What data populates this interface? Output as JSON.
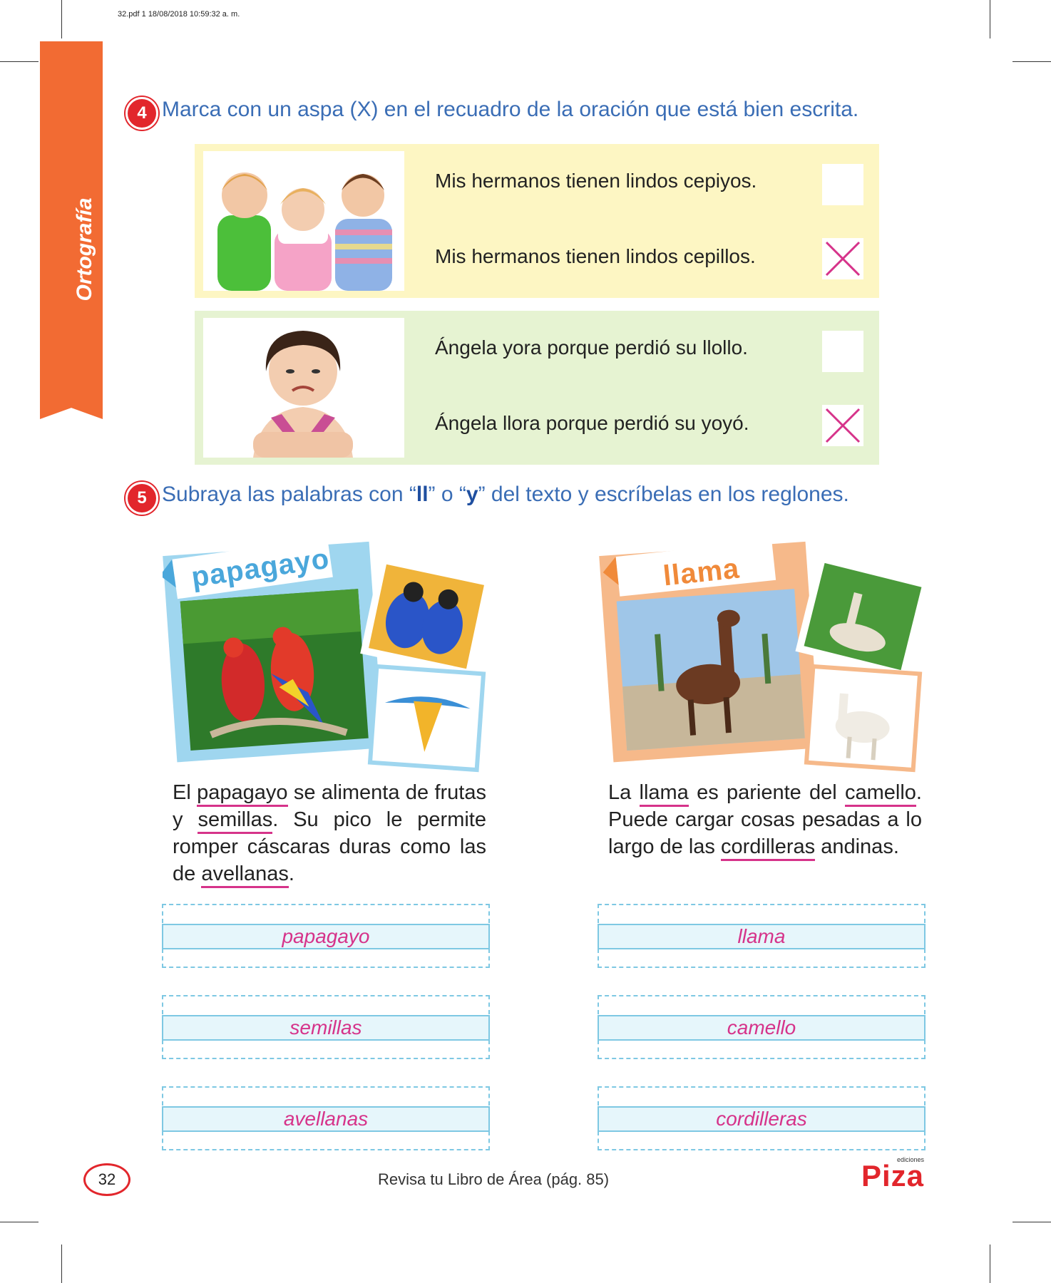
{
  "print_info": "32.pdf   1   18/08/2018   10:59:32 a. m.",
  "side_tab": {
    "label": "Ortografía"
  },
  "colors": {
    "orange": "#f26b33",
    "red": "#e2262c",
    "blue_text": "#3a6db5",
    "magenta": "#d6338a",
    "yellow_panel": "#fdf6c3",
    "green_panel": "#e6f3d2"
  },
  "exercise4": {
    "number": "4",
    "instruction": "Marca con un aspa (X) en el recuadro de la oración que está bien escrita.",
    "groups": [
      {
        "image": "children-brushing-teeth-photo",
        "options": [
          {
            "text": "Mis hermanos tienen lindos cepiyos.",
            "checked": false
          },
          {
            "text": "Mis hermanos tienen lindos cepillos.",
            "checked": true
          }
        ]
      },
      {
        "image": "crying-girl-photo",
        "options": [
          {
            "text": "Ángela yora porque perdió su llollo.",
            "checked": false
          },
          {
            "text": "Ángela llora porque perdió su yoyó.",
            "checked": true
          }
        ]
      }
    ]
  },
  "exercise5": {
    "number": "5",
    "instruction_pre": "Subraya las palabras con “",
    "instruction_ll": "ll",
    "instruction_mid": "” o “",
    "instruction_y": "y",
    "instruction_post": "” del texto y escríbelas en los reglones.",
    "cards": [
      {
        "label": "papagayo",
        "text_parts": [
          [
            "El ",
            false
          ],
          [
            "papagayo",
            true
          ],
          [
            " se alimenta de frutas y ",
            false
          ],
          [
            "semillas",
            true
          ],
          [
            ". Su pico le permite romper cáscaras duras como las de ",
            false
          ],
          [
            "avellanas",
            true
          ],
          [
            ".",
            false
          ]
        ],
        "answers": [
          "papagayo",
          "semillas",
          "avellanas"
        ]
      },
      {
        "label": "llama",
        "text_parts": [
          [
            "La ",
            false
          ],
          [
            "llama",
            true
          ],
          [
            " es pariente del ",
            false
          ],
          [
            "camello",
            true
          ],
          [
            ". Puede cargar cosas pesadas a lo largo de las ",
            false
          ],
          [
            "cordilleras",
            true
          ],
          [
            " andinas.",
            false
          ]
        ],
        "answers": [
          "llama",
          "camello",
          "cordilleras"
        ]
      }
    ]
  },
  "footer": {
    "page_number": "32",
    "reference": "Revisa tu Libro de Área (pág. 85)",
    "logo": "Piza",
    "logo_sub": "ediciones"
  }
}
